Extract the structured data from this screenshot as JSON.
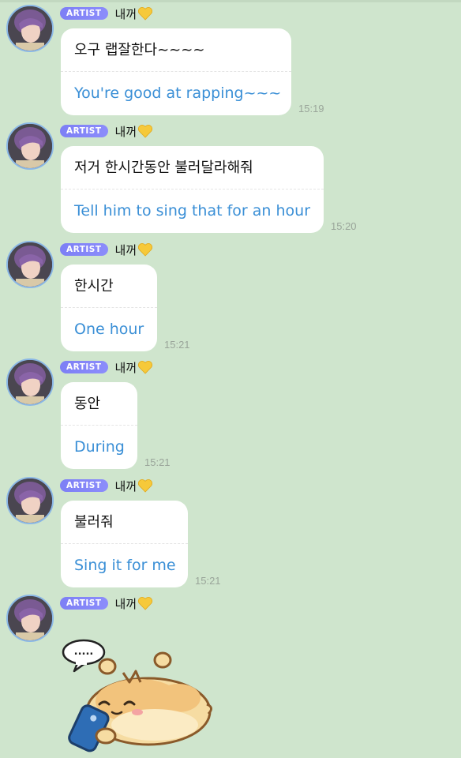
{
  "badge_label": "ARTIST",
  "sender_name": "내꺼",
  "heart_icon": "yellow-heart-icon",
  "colors": {
    "background": "#cfe5cd",
    "translation": "#3a8fd6",
    "badge": "#7d7ff5"
  },
  "messages": [
    {
      "original": "오구 랩잘한다~~~~",
      "translation": "You're good at rapping~~~",
      "time": "15:19"
    },
    {
      "original": "저거 한시간동안 불러달라해줘",
      "translation": "Tell him to sing that for an hour",
      "time": "15:20"
    },
    {
      "original": "한시간",
      "translation": "One hour",
      "time": "15:21"
    },
    {
      "original": "동안",
      "translation": "During",
      "time": "15:21"
    },
    {
      "original": "불러줘",
      "translation": "Sing it for me",
      "time": "15:21"
    }
  ],
  "sticker": {
    "name": "hamster-phone-sticker",
    "speech_text": "....."
  }
}
